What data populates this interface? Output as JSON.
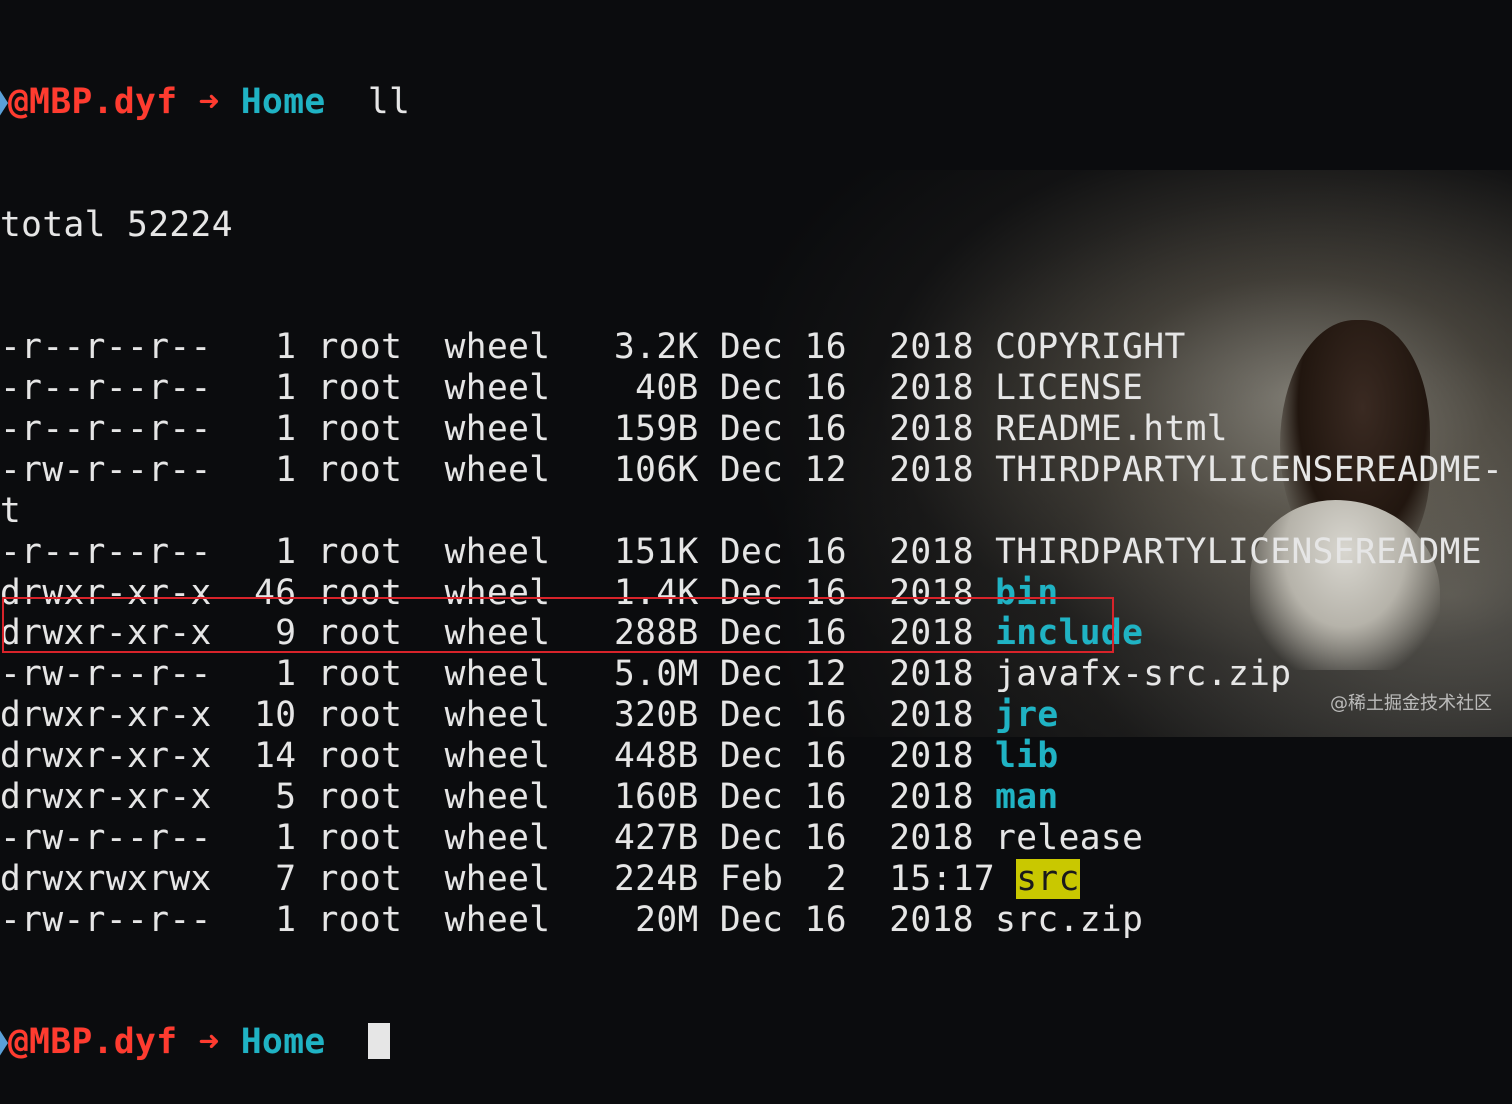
{
  "prompt_top": {
    "user": "@MBP.dyf",
    "arrow": "➜",
    "dir": "Home",
    "command": "ll"
  },
  "total": "total 52224",
  "rows": [
    {
      "perm": "-r--r--r--",
      "links": " 1",
      "owner": "root",
      "group": "wheel",
      "size": "3.2K",
      "month": "Dec",
      "day": "16",
      "time": "2018",
      "name": "COPYRIGHT",
      "type": "file"
    },
    {
      "perm": "-r--r--r--",
      "links": " 1",
      "owner": "root",
      "group": "wheel",
      "size": " 40B",
      "month": "Dec",
      "day": "16",
      "time": "2018",
      "name": "LICENSE",
      "type": "file"
    },
    {
      "perm": "-r--r--r--",
      "links": " 1",
      "owner": "root",
      "group": "wheel",
      "size": "159B",
      "month": "Dec",
      "day": "16",
      "time": "2018",
      "name": "README.html",
      "type": "file"
    },
    {
      "perm": "-rw-r--r--",
      "links": " 1",
      "owner": "root",
      "group": "wheel",
      "size": "106K",
      "month": "Dec",
      "day": "12",
      "time": "2018",
      "name": "THIRDPARTYLICENSEREADME-",
      "type": "file",
      "wrap": "t"
    },
    {
      "perm": "-r--r--r--",
      "links": " 1",
      "owner": "root",
      "group": "wheel",
      "size": "151K",
      "month": "Dec",
      "day": "16",
      "time": "2018",
      "name": "THIRDPARTYLICENSEREADME",
      "type": "file"
    },
    {
      "perm": "drwxr-xr-x",
      "links": "46",
      "owner": "root",
      "group": "wheel",
      "size": "1.4K",
      "month": "Dec",
      "day": "16",
      "time": "2018",
      "name": "bin",
      "type": "dir"
    },
    {
      "perm": "drwxr-xr-x",
      "links": " 9",
      "owner": "root",
      "group": "wheel",
      "size": "288B",
      "month": "Dec",
      "day": "16",
      "time": "2018",
      "name": "include",
      "type": "dir"
    },
    {
      "perm": "-rw-r--r--",
      "links": " 1",
      "owner": "root",
      "group": "wheel",
      "size": "5.0M",
      "month": "Dec",
      "day": "12",
      "time": "2018",
      "name": "javafx-src.zip",
      "type": "file"
    },
    {
      "perm": "drwxr-xr-x",
      "links": "10",
      "owner": "root",
      "group": "wheel",
      "size": "320B",
      "month": "Dec",
      "day": "16",
      "time": "2018",
      "name": "jre",
      "type": "dir"
    },
    {
      "perm": "drwxr-xr-x",
      "links": "14",
      "owner": "root",
      "group": "wheel",
      "size": "448B",
      "month": "Dec",
      "day": "16",
      "time": "2018",
      "name": "lib",
      "type": "dir"
    },
    {
      "perm": "drwxr-xr-x",
      "links": " 5",
      "owner": "root",
      "group": "wheel",
      "size": "160B",
      "month": "Dec",
      "day": "16",
      "time": "2018",
      "name": "man",
      "type": "dir"
    },
    {
      "perm": "-rw-r--r--",
      "links": " 1",
      "owner": "root",
      "group": "wheel",
      "size": "427B",
      "month": "Dec",
      "day": "16",
      "time": "2018",
      "name": "release",
      "type": "file"
    },
    {
      "perm": "drwxrwxrwx",
      "links": " 7",
      "owner": "root",
      "group": "wheel",
      "size": "224B",
      "month": "Feb",
      "day": " 2",
      "time": "15:17",
      "name": "src",
      "type": "dir-hl"
    },
    {
      "perm": "-rw-r--r--",
      "links": " 1",
      "owner": "root",
      "group": "wheel",
      "size": " 20M",
      "month": "Dec",
      "day": "16",
      "time": "2018",
      "name": "src.zip",
      "type": "file"
    }
  ],
  "prompt_bottom": {
    "user": "@MBP.dyf",
    "arrow": "➜",
    "dir": "Home"
  },
  "watermark": "@稀土掘金技术社区",
  "colors": {
    "prompt_user": "#ff3b2f",
    "dir": "#1fb3c4",
    "highlight_bg": "#c9c800",
    "box": "#d8232a"
  }
}
